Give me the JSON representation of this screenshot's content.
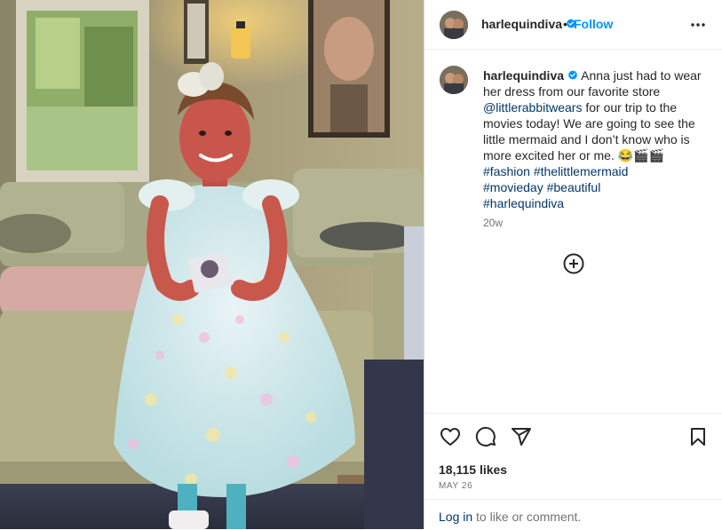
{
  "post": {
    "username": "harlequindiva",
    "follow_label": "Follow",
    "separator": "•",
    "caption": {
      "text1": "Anna just had to wear her dress from our favorite store ",
      "mention": "@littlerabbitwears",
      "text2": " for our trip to the movies today! We are going to see the little mermaid and I don’t know who is more excited her or me. ",
      "emoji": "😂🎬🎬",
      "hashtags": [
        "#fashion",
        "#thelittlemermaid",
        "#movieday",
        "#beautiful",
        "#harlequindiva"
      ]
    },
    "time_ago": "20w",
    "likes": "18,115 likes",
    "date": "MAY 26",
    "login_link": "Log in",
    "login_text": " to like or comment."
  },
  "icons": {
    "verified": "verified-badge-icon",
    "more": "more-options-icon",
    "add_comment": "add-comment-icon",
    "like": "heart-icon",
    "comment": "comment-icon",
    "share": "share-icon",
    "save": "bookmark-icon"
  },
  "colors": {
    "link": "#00376b",
    "follow": "#0095f6",
    "verified": "#0095f6",
    "secondary_text": "#737373"
  }
}
